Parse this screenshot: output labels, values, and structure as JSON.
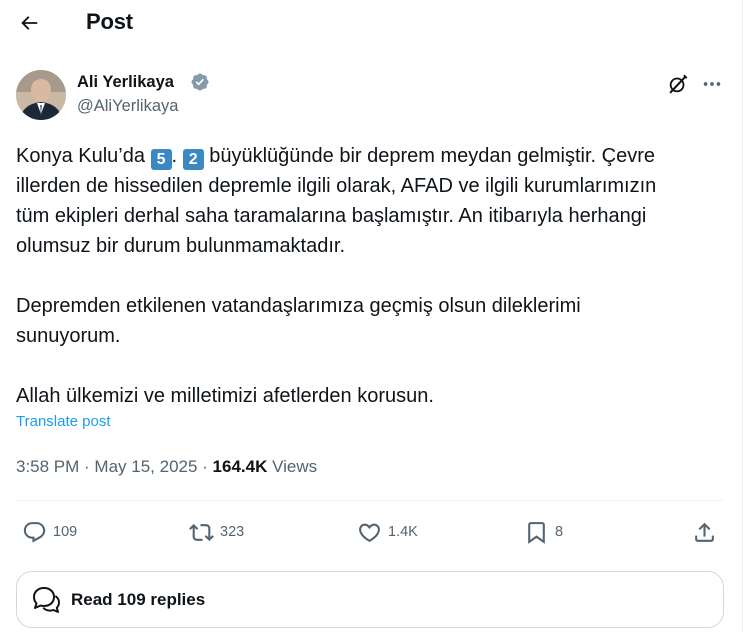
{
  "header": {
    "title": "Post"
  },
  "author": {
    "name": "Ali Yerlikaya",
    "handle": "@AliYerlikaya"
  },
  "tweet": {
    "l1_pre": "Konya Kulu’da ",
    "key1": "5",
    "l1_mid": ". ",
    "key2": "2",
    "l1_post": " büyüklüğünde bir deprem meydan gelmiştir. Çevre",
    "l2": "illerden de hissedilen depremle ilgili olarak, AFAD ve ilgili kurumlarımızın",
    "l3": "tüm ekipleri derhal saha taramalarına başlamıştır. An itibarıyla herhangi",
    "l4": "olumsuz bir durum bulunmamaktadır.",
    "l5": "Depremden etkilenen vatandaşlarımıza geçmiş olsun dileklerimi",
    "l6": "sunuyorum.",
    "l7": "Allah ülkemizi ve milletimizi afetlerden korusun."
  },
  "translate_label": "Translate post",
  "meta": {
    "time": "3:58 PM",
    "sep": " · ",
    "date": "May 15, 2025",
    "views_count": "164.4K",
    "views_label": " Views"
  },
  "actions": {
    "replies": "109",
    "reposts": "323",
    "likes": "1.4K",
    "bookmarks": "8"
  },
  "read_replies_label": "Read 109 replies",
  "colors": {
    "accent": "#1d9bf0",
    "verified": "#829aab",
    "keycap": "#3b88c3",
    "muted_text": "#536471"
  },
  "icons": [
    "back-arrow-icon",
    "verified-badge-icon",
    "grok-icon",
    "more-icon",
    "reply-icon",
    "repost-icon",
    "like-icon",
    "bookmark-icon",
    "share-icon",
    "chat-bubbles-icon"
  ]
}
